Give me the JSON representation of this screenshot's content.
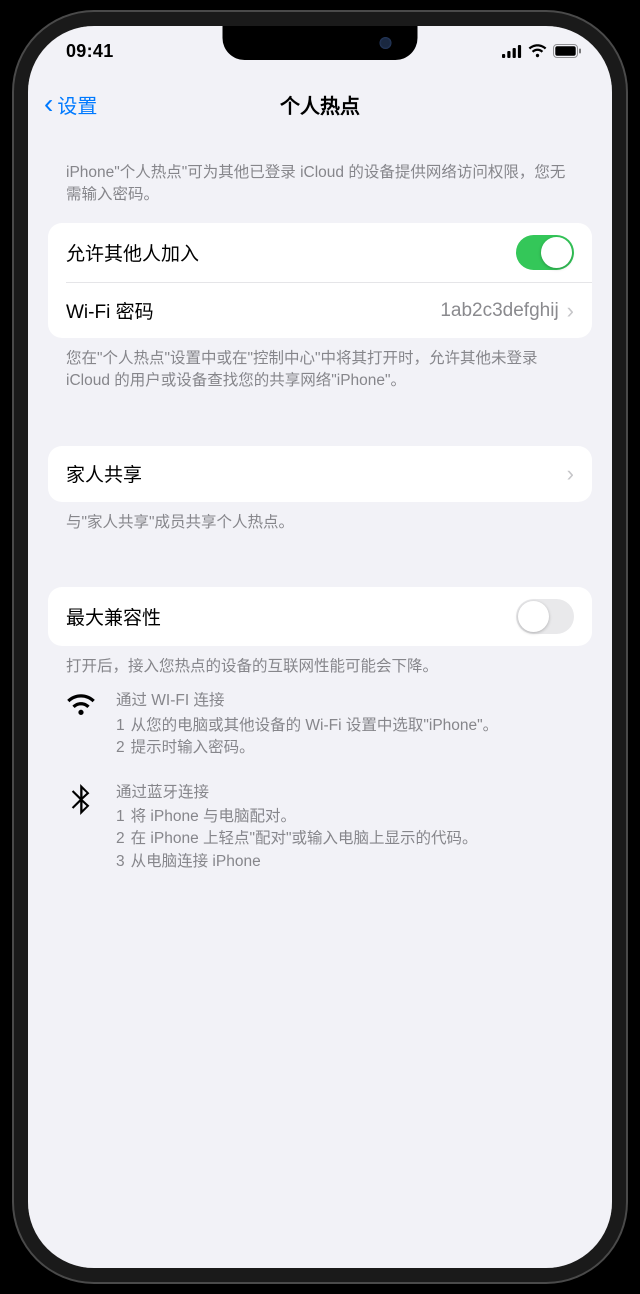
{
  "status": {
    "time": "09:41"
  },
  "nav": {
    "back": "设置",
    "title": "个人热点"
  },
  "intro": "iPhone\"个人热点\"可为其他已登录 iCloud 的设备提供网络访问权限，您无需输入密码。",
  "rows": {
    "allowOthers": "允许其他人加入",
    "wifiPasswordLabel": "Wi-Fi 密码",
    "wifiPasswordValue": "1ab2c3defghij",
    "familySharing": "家人共享",
    "maxCompat": "最大兼容性"
  },
  "footers": {
    "allow": "您在\"个人热点\"设置中或在\"控制中心\"中将其打开时，允许其他未登录 iCloud 的用户或设备查找您的共享网络\"iPhone\"。",
    "family": "与\"家人共享\"成员共享个人热点。",
    "compat": "打开后，接入您热点的设备的互联网性能可能会下降。"
  },
  "instructions": {
    "wifi": {
      "title": "通过 WI-FI 连接",
      "step1": "从您的电脑或其他设备的 Wi-Fi 设置中选取\"iPhone\"。",
      "step2": "提示时输入密码。"
    },
    "bt": {
      "title": "通过蓝牙连接",
      "step1": "将 iPhone 与电脑配对。",
      "step2": "在 iPhone 上轻点\"配对\"或输入电脑上显示的代码。",
      "step3": "从电脑连接 iPhone"
    }
  }
}
